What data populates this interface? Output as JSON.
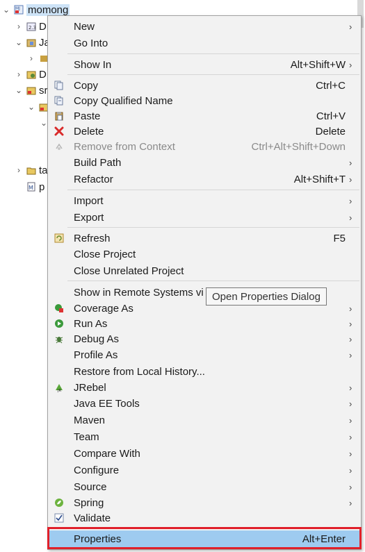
{
  "tree": {
    "root_label": "momong",
    "rows": [
      {
        "label": "D",
        "icon": "deployment-descriptor-icon"
      },
      {
        "label": "Ja",
        "icon": "java-resources-icon"
      },
      {
        "label": "",
        "icon": "jar-icon"
      },
      {
        "label": "D",
        "icon": "deployed-resources-icon"
      },
      {
        "label": "sr",
        "icon": "src-folder-icon"
      },
      {
        "label": "",
        "icon": "folder-icon"
      },
      {
        "label": "",
        "icon": ""
      },
      {
        "label": "ta",
        "icon": "target-folder-icon"
      },
      {
        "label": "p",
        "icon": "maven-pom-icon"
      }
    ]
  },
  "context_menu": {
    "items": [
      {
        "label": "New",
        "shortcut": "",
        "submenu": true,
        "icon": ""
      },
      {
        "label": "Go Into",
        "shortcut": "",
        "submenu": false,
        "icon": ""
      },
      {
        "label": "Show In",
        "shortcut": "Alt+Shift+W",
        "submenu": true,
        "icon": ""
      },
      {
        "label": "Copy",
        "shortcut": "Ctrl+C",
        "submenu": false,
        "icon": "copy-icon"
      },
      {
        "label": "Copy Qualified Name",
        "shortcut": "",
        "submenu": false,
        "icon": "copy-qualified-name-icon"
      },
      {
        "label": "Paste",
        "shortcut": "Ctrl+V",
        "submenu": false,
        "icon": "paste-icon"
      },
      {
        "label": "Delete",
        "shortcut": "Delete",
        "submenu": false,
        "icon": "delete-icon"
      },
      {
        "label": "Remove from Context",
        "shortcut": "Ctrl+Alt+Shift+Down",
        "submenu": false,
        "icon": "remove-from-context-icon",
        "disabled": true
      },
      {
        "label": "Build Path",
        "shortcut": "",
        "submenu": true,
        "icon": ""
      },
      {
        "label": "Refactor",
        "shortcut": "Alt+Shift+T",
        "submenu": true,
        "icon": ""
      },
      {
        "label": "Import",
        "shortcut": "",
        "submenu": true,
        "icon": ""
      },
      {
        "label": "Export",
        "shortcut": "",
        "submenu": true,
        "icon": ""
      },
      {
        "label": "Refresh",
        "shortcut": "F5",
        "submenu": false,
        "icon": "refresh-icon"
      },
      {
        "label": "Close Project",
        "shortcut": "",
        "submenu": false,
        "icon": ""
      },
      {
        "label": "Close Unrelated Project",
        "shortcut": "",
        "submenu": false,
        "icon": ""
      },
      {
        "label": "Show in Remote Systems vi",
        "shortcut": "",
        "submenu": false,
        "icon": ""
      },
      {
        "label": "Coverage As",
        "shortcut": "",
        "submenu": true,
        "icon": "coverage-icon"
      },
      {
        "label": "Run As",
        "shortcut": "",
        "submenu": true,
        "icon": "run-icon"
      },
      {
        "label": "Debug As",
        "shortcut": "",
        "submenu": true,
        "icon": "debug-icon"
      },
      {
        "label": "Profile As",
        "shortcut": "",
        "submenu": true,
        "icon": ""
      },
      {
        "label": "Restore from Local History...",
        "shortcut": "",
        "submenu": false,
        "icon": ""
      },
      {
        "label": "JRebel",
        "shortcut": "",
        "submenu": true,
        "icon": "jrebel-icon"
      },
      {
        "label": "Java EE Tools",
        "shortcut": "",
        "submenu": true,
        "icon": ""
      },
      {
        "label": "Maven",
        "shortcut": "",
        "submenu": true,
        "icon": ""
      },
      {
        "label": "Team",
        "shortcut": "",
        "submenu": true,
        "icon": ""
      },
      {
        "label": "Compare With",
        "shortcut": "",
        "submenu": true,
        "icon": ""
      },
      {
        "label": "Configure",
        "shortcut": "",
        "submenu": true,
        "icon": ""
      },
      {
        "label": "Source",
        "shortcut": "",
        "submenu": true,
        "icon": ""
      },
      {
        "label": "Spring",
        "shortcut": "",
        "submenu": true,
        "icon": "spring-icon"
      },
      {
        "label": "Validate",
        "shortcut": "",
        "submenu": false,
        "icon": "validate-checkbox-icon"
      },
      {
        "label": "Properties",
        "shortcut": "Alt+Enter",
        "submenu": false,
        "icon": "",
        "highlighted": true
      }
    ]
  },
  "tooltip": {
    "text": "Open Properties Dialog"
  },
  "colors": {
    "highlight": "#9ecbf0",
    "focus_outline": "#e0202a",
    "selection": "#cde3f7"
  }
}
